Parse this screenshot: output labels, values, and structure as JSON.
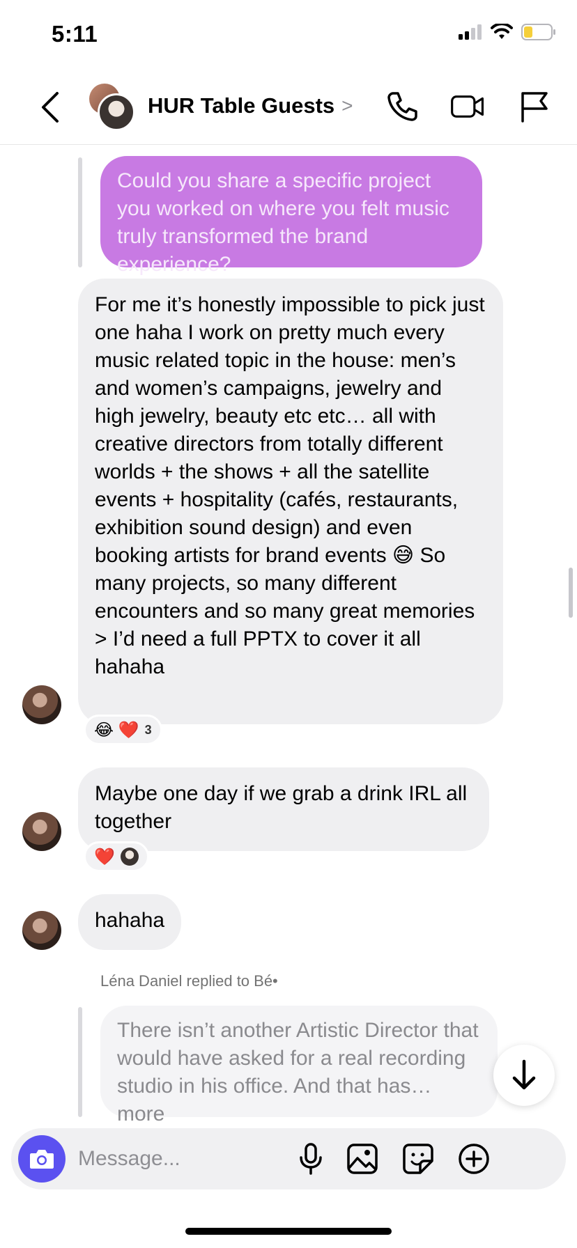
{
  "status_bar": {
    "time": "5:11",
    "icons": [
      "cellular-signal-icon",
      "wifi-icon",
      "battery-icon"
    ]
  },
  "header": {
    "title": "HUR Table Guests",
    "chevron": ">",
    "icons": [
      "back-chevron-icon",
      "phone-icon",
      "video-camera-icon",
      "flag-icon"
    ]
  },
  "messages": {
    "quoted_outgoing": "Could you share a specific project you worked on where you felt music truly transformed the brand experience?",
    "long_reply": "For me it’s honestly impossible to pick just one haha I work on pretty much every music related topic in the house: men’s and women’s campaigns, jewelry and high jewelry, beauty etc etc… all with creative directors from totally different worlds + the shows + all the satellite events + hospitality (cafés, restaurants, exhibition sound design) and even booking artists for brand events 😅 So many projects, so many different encounters and so many great memories > I’d need a full PPTX to cover it all hahaha",
    "long_reply_reactions": {
      "emoji": "😂 ❤️",
      "count": "3"
    },
    "drink": "Maybe one day if we grab a drink IRL all together",
    "drink_reactions": {
      "emoji": "❤️"
    },
    "haha": "hahaha",
    "reply_label": "Léna Daniel replied to Bé•",
    "quoted_reply": "There isn’t another Artistic Director that would have asked for a real recording studio in his office. And that has… more"
  },
  "composer": {
    "placeholder": "Message...",
    "icons": [
      "camera-icon",
      "microphone-icon",
      "image-icon",
      "sticker-icon",
      "plus-circle-icon"
    ]
  },
  "colors": {
    "accent": "#5b51f0",
    "quoted_bubble": "#c87ae3",
    "incoming_bubble": "#efeff1"
  }
}
